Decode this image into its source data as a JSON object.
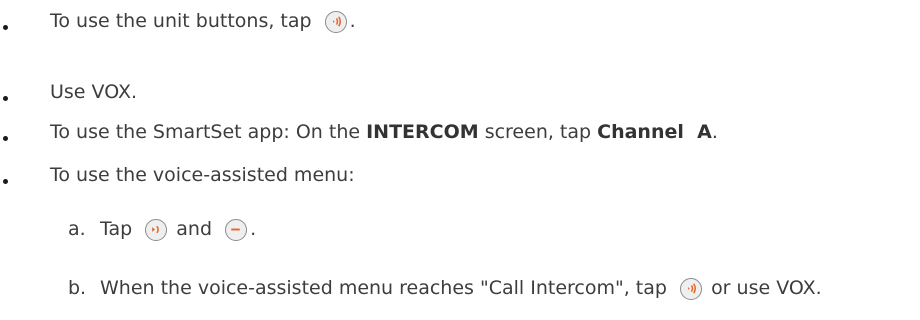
{
  "items": [
    {
      "pre": "To use the unit buttons, tap",
      "post": "."
    },
    {
      "text": "Use VOX."
    },
    {
      "pre": "To use the SmartSet app: On the ",
      "bold1": "INTERCOM",
      "mid": " screen, tap ",
      "bold2": "Channel  A",
      "post": "."
    },
    {
      "text": "To use the voice-assisted menu:"
    }
  ],
  "sub": [
    {
      "marker": "a.",
      "pre": "Tap",
      "mid": "and",
      "post": "."
    },
    {
      "marker": "b.",
      "pre": "When the voice-assisted menu reaches \"Call Intercom\", tap",
      "post": "or use VOX."
    }
  ],
  "colors": {
    "icon_accent": "#e8622a",
    "text": "#3d3d3d"
  },
  "icons": [
    "intercom-button-icon",
    "phone-button-icon",
    "minus-button-icon"
  ]
}
